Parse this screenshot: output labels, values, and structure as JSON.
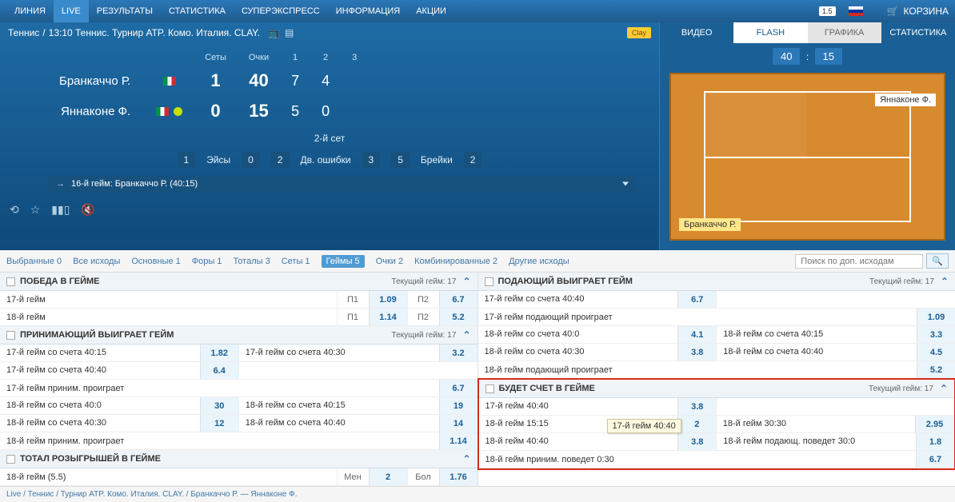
{
  "nav": {
    "items": [
      "ЛИНИЯ",
      "LIVE",
      "РЕЗУЛЬТАТЫ",
      "СТАТИСТИКА",
      "СУПЕРЭКСПРЕСС",
      "ИНФОРМАЦИЯ",
      "АКЦИИ"
    ],
    "active_index": 1,
    "corner_badge": "1.5",
    "basket": "КОРЗИНА"
  },
  "breadcrumb": {
    "sport": "Теннис",
    "sep": "/",
    "event": "13:10 Теннис. Турнир ATP. Комо. Италия. CLAY.",
    "surface_tag": "Clay"
  },
  "score": {
    "headers": [
      "Сеты",
      "Очки",
      "1",
      "2",
      "3"
    ],
    "players": [
      {
        "name": "Бранкаччо Р.",
        "serving": false,
        "sets": "1",
        "points": "40",
        "s1": "7",
        "s2": "4",
        "s3": ""
      },
      {
        "name": "Яннаконе Ф.",
        "serving": true,
        "sets": "0",
        "points": "15",
        "s1": "5",
        "s2": "0",
        "s3": ""
      }
    ],
    "set_label": "2-й сет",
    "stats": [
      {
        "l": "1",
        "name": "Эйсы",
        "r": "0"
      },
      {
        "l": "2",
        "name": "Дв. ошибки",
        "r": "3"
      },
      {
        "l": "5",
        "name": "Брейки",
        "r": "2"
      }
    ],
    "ticker": "16-й гейм: Бранкаччо Р. (40:15)"
  },
  "right": {
    "tabs": [
      "ВИДЕО",
      "FLASH",
      "ГРАФИКА",
      "СТАТИСТИКА"
    ],
    "score_l": "40",
    "score_r": "15",
    "player_top": "Яннаконе Ф.",
    "player_bot": "Бранкаччо Р."
  },
  "filters": {
    "items": [
      "Выбранные 0",
      "Все исходы",
      "Основные 1",
      "Форы 1",
      "Тоталы 3",
      "Сеты 1",
      "Геймы 5",
      "Очки 2",
      "Комбинированные 2",
      "Другие исходы"
    ],
    "active_index": 6,
    "search_placeholder": "Поиск по доп. исходам"
  },
  "markets_left": [
    {
      "title": "ПОБЕДА В ГЕЙМЕ",
      "meta": "Текущий гейм: 17",
      "rows": [
        {
          "type": "pair",
          "l_label": "17-й гейм",
          "l_sub": "П1",
          "l_odds": "1.09",
          "r_label": "П2",
          "r_odds": "6.7"
        },
        {
          "type": "pair",
          "l_label": "18-й гейм",
          "l_sub": "П1",
          "l_odds": "1.14",
          "r_label": "П2",
          "r_odds": "5.2"
        }
      ]
    },
    {
      "title": "ПРИНИМАЮЩИЙ ВЫИГРАЕТ ГЕЙМ",
      "meta": "Текущий гейм: 17",
      "rows": [
        {
          "type": "half",
          "l_label": "17-й гейм со счета 40:15",
          "l_odds": "1.82",
          "r_label": "17-й гейм со счета 40:30",
          "r_odds": "3.2"
        },
        {
          "type": "single",
          "label": "17-й гейм со счета 40:40",
          "odds": "6.4"
        },
        {
          "type": "single_r",
          "label": "17-й гейм приним. проиграет",
          "odds": "6.7"
        },
        {
          "type": "half",
          "l_label": "18-й гейм со счета 40:0",
          "l_odds": "30",
          "r_label": "18-й гейм со счета 40:15",
          "r_odds": "19"
        },
        {
          "type": "half",
          "l_label": "18-й гейм со счета 40:30",
          "l_odds": "12",
          "r_label": "18-й гейм со счета 40:40",
          "r_odds": "14"
        },
        {
          "type": "single_r",
          "label": "18-й гейм приним. проиграет",
          "odds": "1.14"
        }
      ]
    },
    {
      "title": "ТОТАЛ РОЗЫГРЫШЕЙ В ГЕЙМЕ",
      "meta": "",
      "rows": [
        {
          "type": "tot",
          "label": "18-й гейм (5.5)",
          "l_sub": "Мен",
          "l_odds": "2",
          "r_sub": "Бол",
          "r_odds": "1.76"
        }
      ]
    }
  ],
  "markets_right": [
    {
      "title": "ПОДАЮЩИЙ ВЫИГРАЕТ ГЕЙМ",
      "meta": "Текущий гейм: 17",
      "rows": [
        {
          "type": "single",
          "label": "17-й гейм со счета 40:40",
          "odds": "6.7"
        },
        {
          "type": "single_r",
          "label": "17-й гейм подающий проиграет",
          "odds": "1.09"
        },
        {
          "type": "half",
          "l_label": "18-й гейм со счета 40:0",
          "l_odds": "4.1",
          "r_label": "18-й гейм со счета 40:15",
          "r_odds": "3.3"
        },
        {
          "type": "half",
          "l_label": "18-й гейм со счета 40:30",
          "l_odds": "3.8",
          "r_label": "18-й гейм со счета 40:40",
          "r_odds": "4.5"
        },
        {
          "type": "single_r",
          "label": "18-й гейм подающий проиграет",
          "odds": "5.2"
        }
      ]
    },
    {
      "title": "БУДЕТ СЧЕТ В ГЕЙМЕ",
      "meta": "Текущий гейм: 17",
      "highlighted": true,
      "rows": [
        {
          "type": "single",
          "label": "17-й гейм 40:40",
          "odds": "3.8"
        },
        {
          "type": "half_tt",
          "l_label": "18-й гейм 15:15",
          "l_odds": "2",
          "r_label": "18-й гейм 30:30",
          "r_odds": "2.95",
          "tooltip": "17-й гейм 40:40"
        },
        {
          "type": "half",
          "l_label": "18-й гейм 40:40",
          "l_odds": "3.8",
          "r_label": "18-й гейм подающ. поведет 30:0",
          "r_odds": "1.8"
        },
        {
          "type": "single_r",
          "label": "18-й гейм приним. поведет 0:30",
          "odds": "6.7"
        }
      ]
    }
  ],
  "footer": "Live / Теннис / Турнир ATP. Комо. Италия. CLAY. / Бранкаччо Р. — Яннаконе Ф."
}
